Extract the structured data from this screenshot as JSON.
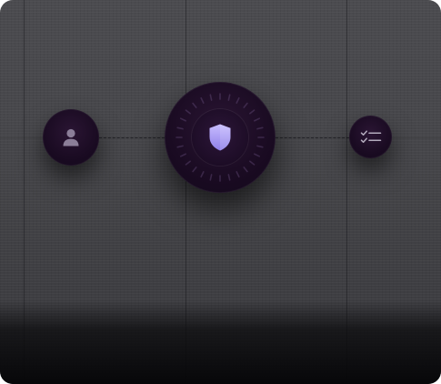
{
  "colors": {
    "background": "#47474b",
    "node_fill": "#1a0b22",
    "shield_accent": "#a99cf5",
    "icon_muted": "#8b7e98"
  },
  "nodes": [
    {
      "id": "user",
      "icon": "user-icon"
    },
    {
      "id": "security",
      "icon": "shield-icon"
    },
    {
      "id": "tasks",
      "icon": "checklist-icon"
    }
  ]
}
